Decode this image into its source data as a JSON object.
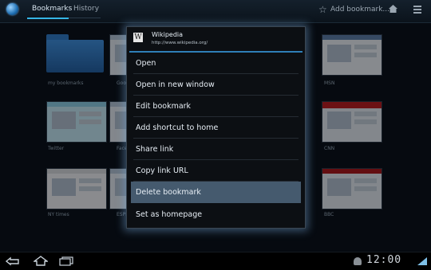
{
  "topbar": {
    "tabs": [
      {
        "label": "Bookmarks",
        "active": true
      },
      {
        "label": "History",
        "active": false
      }
    ],
    "add_bookmark_label": "Add bookmark..."
  },
  "grid": {
    "items": [
      {
        "label": "my bookmarks",
        "type": "folder"
      },
      {
        "label": "Goog",
        "type": "thumb"
      },
      {
        "label": "MSN",
        "type": "thumb"
      },
      {
        "label": "Twitter",
        "type": "thumb"
      },
      {
        "label": "Faceb",
        "type": "thumb"
      },
      {
        "label": "CNN",
        "type": "thumb"
      },
      {
        "label": "NY times",
        "type": "thumb"
      },
      {
        "label": "ESPN",
        "type": "thumb"
      },
      {
        "label": "BBC",
        "type": "thumb"
      }
    ]
  },
  "context_menu": {
    "header": {
      "title": "Wikipedia",
      "url": "http://www.wikipedia.org/",
      "icon": "W"
    },
    "items": [
      {
        "label": "Open"
      },
      {
        "label": "Open in new window"
      },
      {
        "label": "Edit bookmark"
      },
      {
        "label": "Add shortcut to home"
      },
      {
        "label": "Share link"
      },
      {
        "label": "Copy link URL"
      },
      {
        "label": "Delete bookmark",
        "highlighted": true
      },
      {
        "label": "Set as homepage"
      }
    ]
  },
  "statusbar": {
    "time": "12:00"
  },
  "colors": {
    "accent": "#35b5e5",
    "highlight": "#455a6e"
  }
}
